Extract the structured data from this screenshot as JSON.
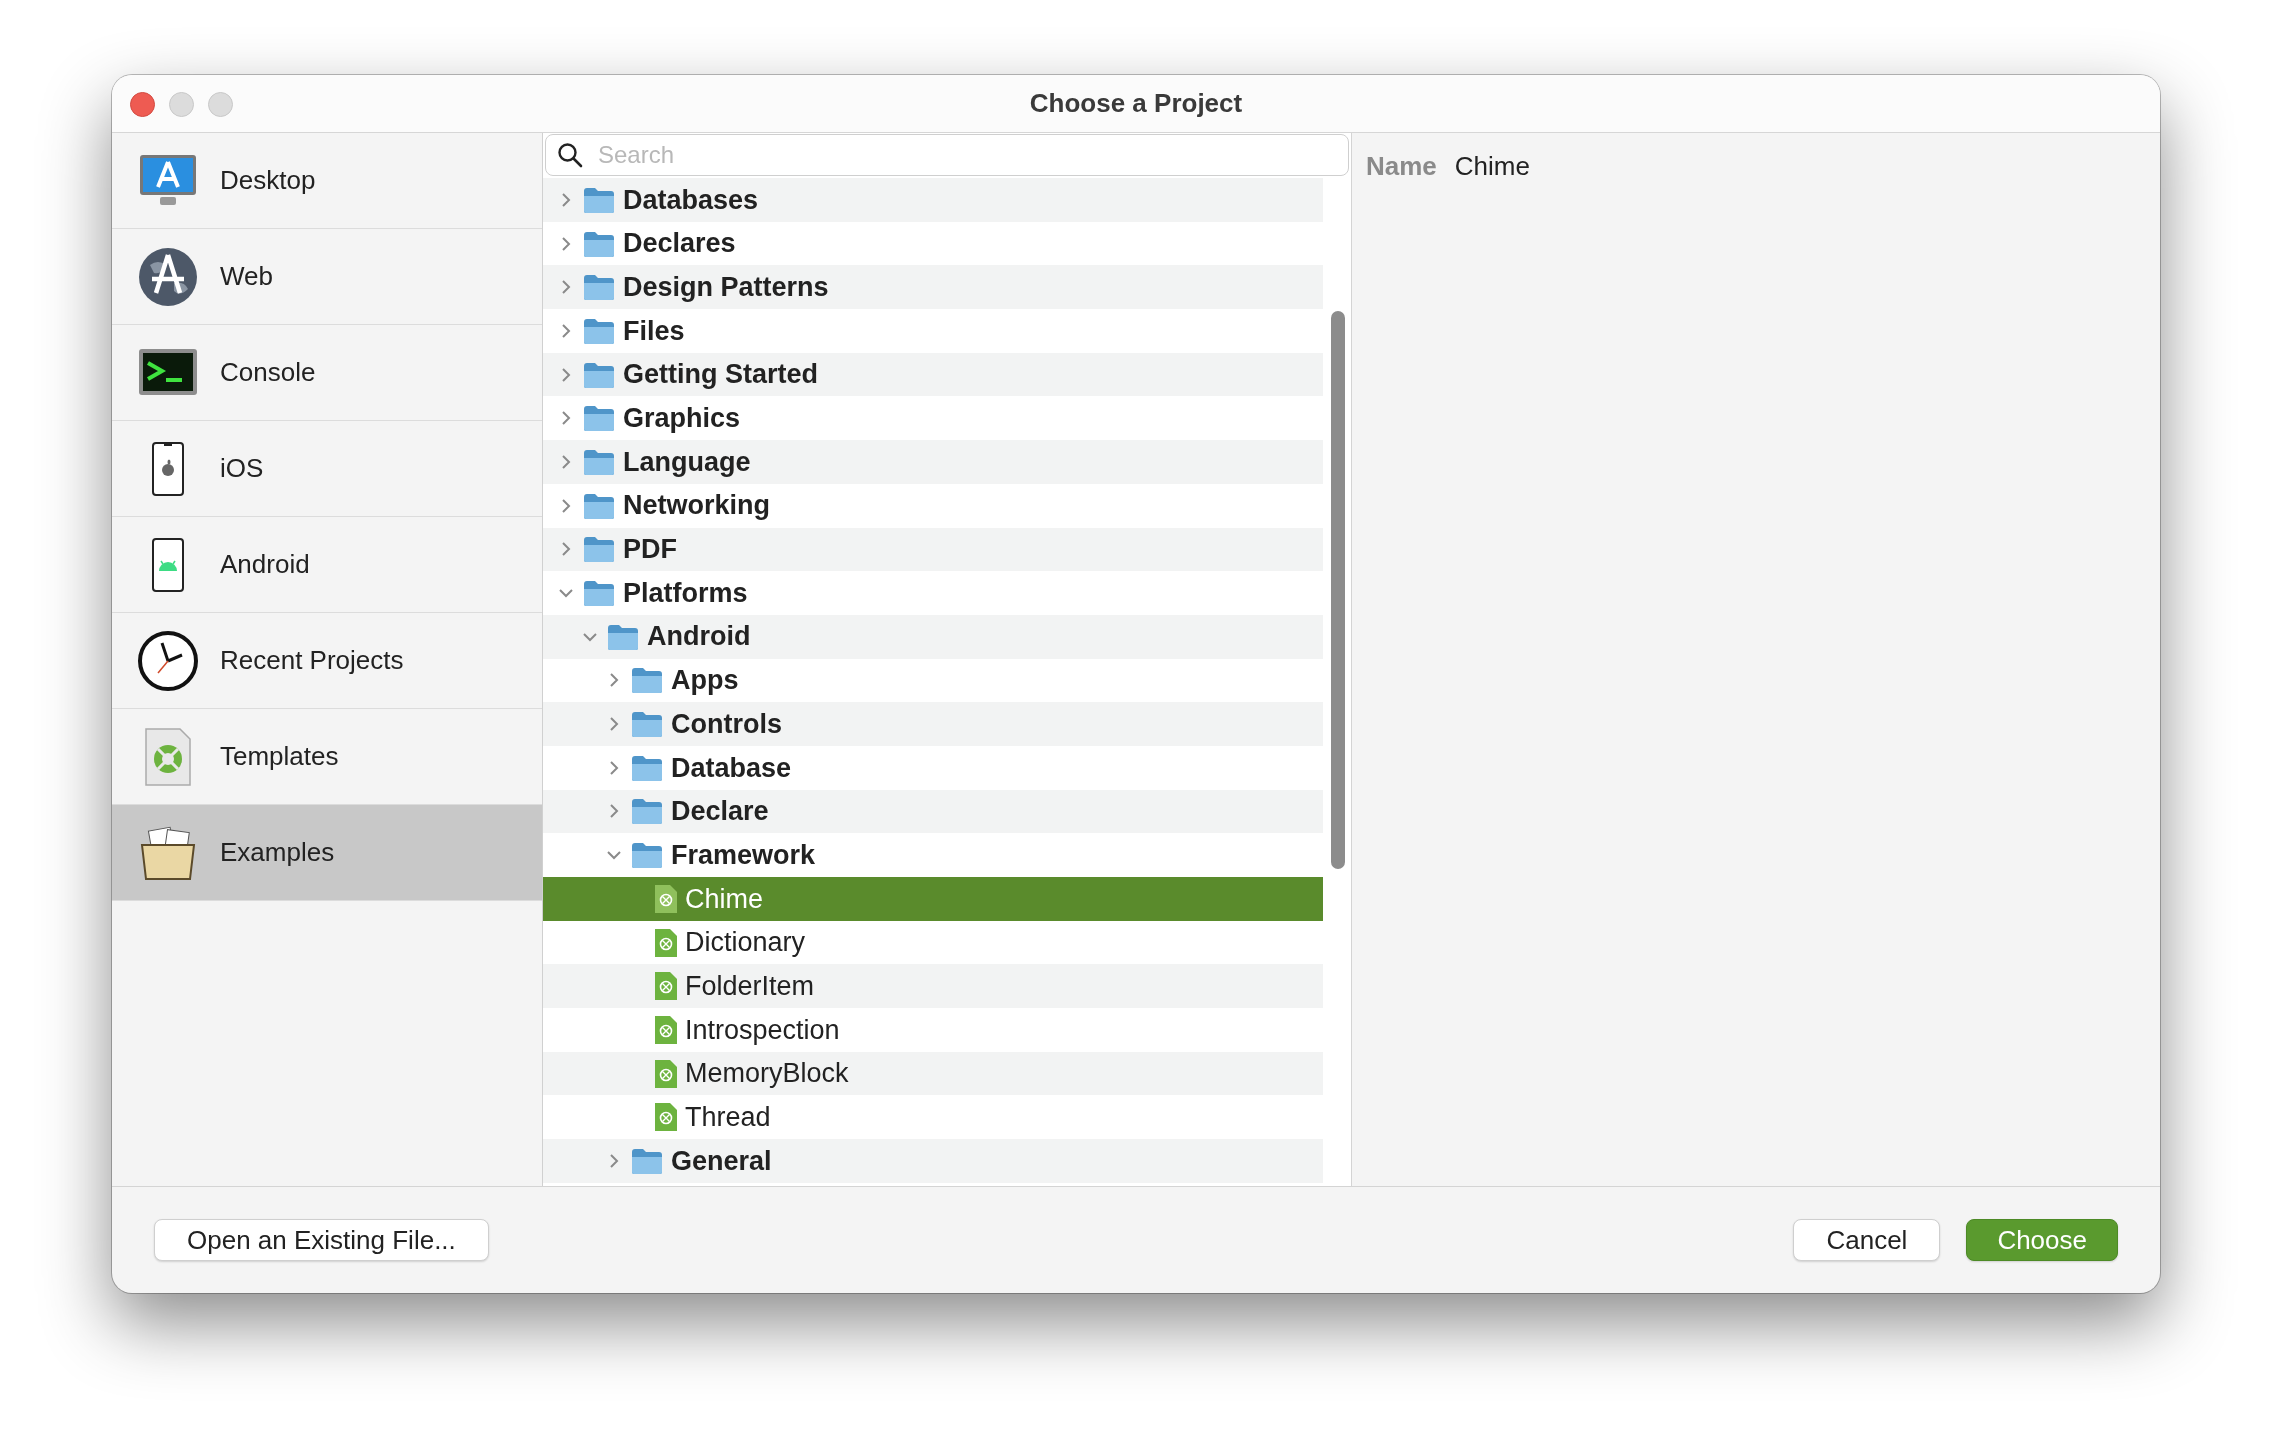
{
  "window": {
    "title": "Choose a Project"
  },
  "sidebar": {
    "items": [
      {
        "label": "Desktop",
        "selected": false
      },
      {
        "label": "Web",
        "selected": false
      },
      {
        "label": "Console",
        "selected": false
      },
      {
        "label": "iOS",
        "selected": false
      },
      {
        "label": "Android",
        "selected": false
      },
      {
        "label": "Recent Projects",
        "selected": false
      },
      {
        "label": "Templates",
        "selected": false
      },
      {
        "label": "Examples",
        "selected": true
      }
    ]
  },
  "search": {
    "placeholder": "Search"
  },
  "tree": [
    {
      "kind": "folder",
      "label": "Databases",
      "expanded": false,
      "selected": false
    },
    {
      "kind": "folder",
      "label": "Declares",
      "expanded": false,
      "selected": false
    },
    {
      "kind": "folder",
      "label": "Design Patterns",
      "expanded": false,
      "selected": false
    },
    {
      "kind": "folder",
      "label": "Files",
      "expanded": false,
      "selected": false
    },
    {
      "kind": "folder",
      "label": "Getting Started",
      "expanded": false,
      "selected": false
    },
    {
      "kind": "folder",
      "label": "Graphics",
      "expanded": false,
      "selected": false
    },
    {
      "kind": "folder",
      "label": "Language",
      "expanded": false,
      "selected": false
    },
    {
      "kind": "folder",
      "label": "Networking",
      "expanded": false,
      "selected": false
    },
    {
      "kind": "folder",
      "label": "PDF",
      "expanded": false,
      "selected": false
    },
    {
      "kind": "folder",
      "label": "Platforms",
      "expanded": true,
      "selected": false,
      "children": [
        {
          "kind": "folder",
          "label": "Android",
          "expanded": true,
          "selected": false,
          "children": [
            {
              "kind": "folder",
              "label": "Apps",
              "expanded": false,
              "selected": false
            },
            {
              "kind": "folder",
              "label": "Controls",
              "expanded": false,
              "selected": false
            },
            {
              "kind": "folder",
              "label": "Database",
              "expanded": false,
              "selected": false
            },
            {
              "kind": "folder",
              "label": "Declare",
              "expanded": false,
              "selected": false
            },
            {
              "kind": "folder",
              "label": "Framework",
              "expanded": true,
              "selected": false,
              "children": [
                {
                  "kind": "file",
                  "label": "Chime",
                  "selected": true
                },
                {
                  "kind": "file",
                  "label": "Dictionary",
                  "selected": false
                },
                {
                  "kind": "file",
                  "label": "FolderItem",
                  "selected": false
                },
                {
                  "kind": "file",
                  "label": "Introspection",
                  "selected": false
                },
                {
                  "kind": "file",
                  "label": "MemoryBlock",
                  "selected": false
                },
                {
                  "kind": "file",
                  "label": "Thread",
                  "selected": false
                }
              ]
            },
            {
              "kind": "folder",
              "label": "General",
              "expanded": false,
              "selected": false
            }
          ]
        }
      ]
    }
  ],
  "detail": {
    "label": "Name",
    "value": "Chime"
  },
  "footer": {
    "buttons": [
      {
        "kind": "default",
        "label": "Open an Existing File..."
      },
      {
        "kind": "default",
        "label": "Cancel"
      },
      {
        "kind": "primary",
        "label": "Choose"
      }
    ]
  }
}
